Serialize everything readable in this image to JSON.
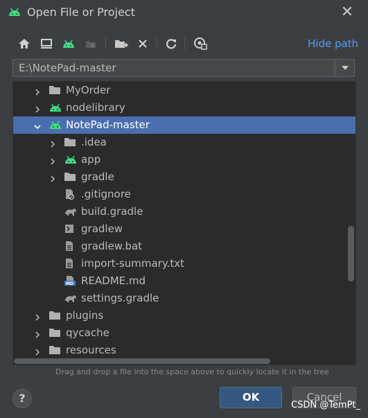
{
  "dialog": {
    "title": "Open File or Project",
    "close": "✕"
  },
  "toolbar": {
    "buttons": [
      {
        "icon": "home-icon"
      },
      {
        "icon": "desktop-icon"
      },
      {
        "icon": "android-project-icon"
      },
      {
        "icon": "module-icon"
      },
      {
        "icon": "new-folder-icon"
      },
      {
        "icon": "delete-icon"
      },
      {
        "icon": "refresh-icon"
      },
      {
        "icon": "show-hidden-icon"
      }
    ],
    "hide_path_label": "Hide path"
  },
  "path": {
    "value": "E:\\NotePad-master"
  },
  "tree": {
    "items": [
      {
        "label": "MyOrder",
        "icon": "folder-icon",
        "level": 1,
        "expanded": false
      },
      {
        "label": "nodelibrary",
        "icon": "android-icon",
        "level": 1,
        "expanded": false
      },
      {
        "label": "NotePad-master",
        "icon": "android-icon",
        "level": 1,
        "expanded": true,
        "selected": true
      },
      {
        "label": ".idea",
        "icon": "folder-icon",
        "level": 2,
        "expanded": false
      },
      {
        "label": "app",
        "icon": "android-icon",
        "level": 2,
        "expanded": false
      },
      {
        "label": "gradle",
        "icon": "folder-icon",
        "level": 2,
        "expanded": false
      },
      {
        "label": ".gitignore",
        "icon": "ignore-file-icon",
        "level": 2,
        "leaf": true
      },
      {
        "label": "build.gradle",
        "icon": "gradle-icon",
        "level": 2,
        "leaf": true
      },
      {
        "label": "gradlew",
        "icon": "shell-icon",
        "level": 2,
        "leaf": true
      },
      {
        "label": "gradlew.bat",
        "icon": "text-file-icon",
        "level": 2,
        "leaf": true
      },
      {
        "label": "import-summary.txt",
        "icon": "text-file-icon",
        "level": 2,
        "leaf": true
      },
      {
        "label": "README.md",
        "icon": "markdown-icon",
        "level": 2,
        "leaf": true
      },
      {
        "label": "settings.gradle",
        "icon": "gradle-icon",
        "level": 2,
        "leaf": true
      },
      {
        "label": "plugins",
        "icon": "folder-icon",
        "level": 1,
        "expanded": false
      },
      {
        "label": "qycache",
        "icon": "folder-icon",
        "level": 1,
        "expanded": false
      },
      {
        "label": "resources",
        "icon": "folder-icon",
        "level": 1,
        "expanded": false
      }
    ]
  },
  "hint": "Drag and drop a file into the space above to quickly locate it in the tree",
  "buttons": {
    "help": "?",
    "ok": "OK",
    "cancel": "Cancel"
  },
  "watermark": "CSDN @TemPt_",
  "colors": {
    "background": "#3c3f41",
    "tree_bg": "#2b2b2b",
    "selection": "#4b6eaf",
    "link": "#589df6",
    "android": "#3ddc84",
    "ok_button": "#365880"
  }
}
